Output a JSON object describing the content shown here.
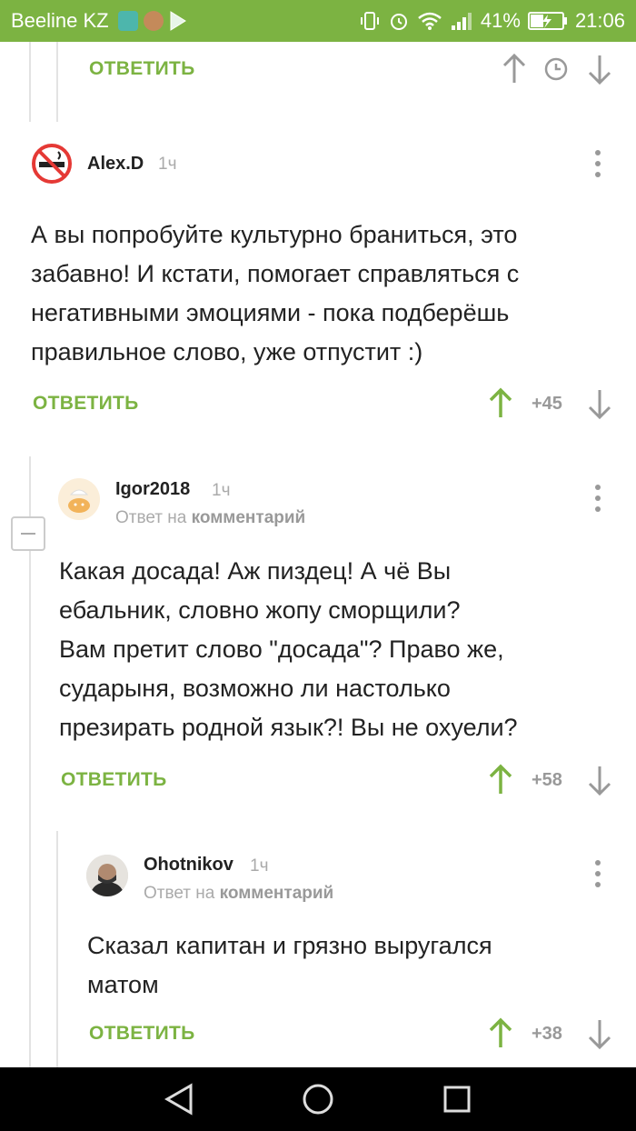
{
  "status_bar": {
    "carrier": "Beeline KZ",
    "battery": "41%",
    "time": "21:06"
  },
  "top_reply": {
    "reply_label": "ОТВЕТИТЬ"
  },
  "comments": [
    {
      "username": "Alex.D",
      "time": "1ч",
      "lines": [
        "А вы попробуйте культурно браниться, это",
        "забавно! И кстати, помогает справляться с",
        "негативными эмоциями - пока подберёшь",
        "правильное слово, уже отпустит :)"
      ],
      "reply_label": "ОТВЕТИТЬ",
      "rating": "+45"
    },
    {
      "username": "Igor2018",
      "time": "1ч",
      "reply_to_prefix": "Ответ на",
      "reply_to_target": "комментарий",
      "lines": [
        "Какая досада! Аж пиздец! А чё Вы",
        "ебальник, словно жопу сморщили?",
        "Вам претит слово \"досада\"? Право же,",
        "сударыня, возможно ли настолько",
        "презирать родной язык?! Вы не охуели?"
      ],
      "reply_label": "ОТВЕТИТЬ",
      "rating": "+58"
    },
    {
      "username": "Ohotnikov",
      "time": "1ч",
      "reply_to_prefix": "Ответ на",
      "reply_to_target": "комментарий",
      "lines": [
        "Сказал капитан и грязно выругался",
        "матом"
      ],
      "reply_label": "ОТВЕТИТЬ",
      "rating": "+38"
    }
  ],
  "colors": {
    "accent": "#7cb342",
    "upvote": "#7cb342",
    "muted": "#999999"
  }
}
